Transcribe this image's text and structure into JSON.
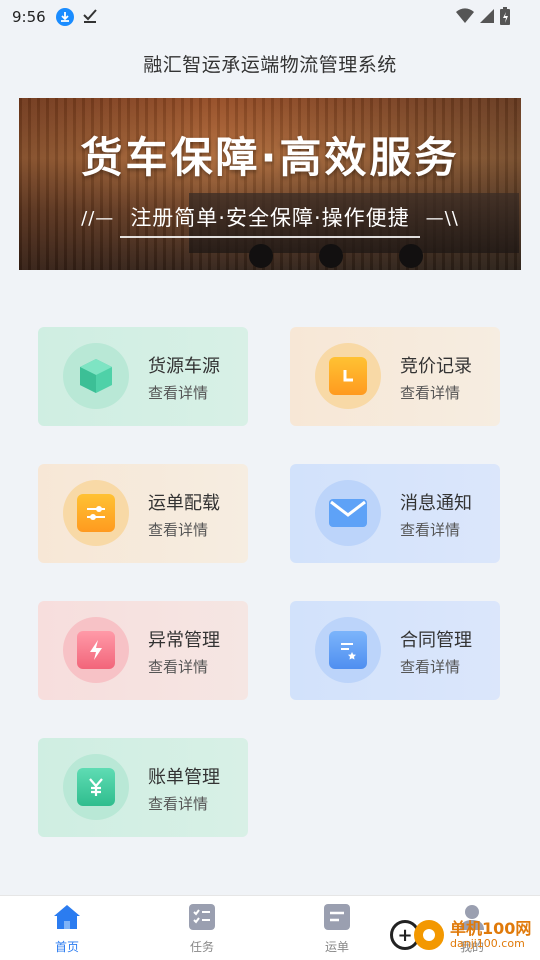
{
  "status_bar": {
    "time": "9:56",
    "icons": [
      "download-icon",
      "check-icon",
      "wifi-icon",
      "signal-icon",
      "battery-icon"
    ]
  },
  "header": {
    "title": "融汇智运承运端物流管理系统"
  },
  "banner": {
    "headline": "货车保障·高效服务",
    "subline": "注册简单·安全保障·操作便捷",
    "left_deco": "//—",
    "right_deco": "—\\\\"
  },
  "cards": [
    {
      "title": "货源车源",
      "subtitle": "查看详情",
      "icon": "cube-icon"
    },
    {
      "title": "竞价记录",
      "subtitle": "查看详情",
      "icon": "clock-icon"
    },
    {
      "title": "运单配载",
      "subtitle": "查看详情",
      "icon": "sliders-icon"
    },
    {
      "title": "消息通知",
      "subtitle": "查看详情",
      "icon": "mail-icon"
    },
    {
      "title": "异常管理",
      "subtitle": "查看详情",
      "icon": "lightning-icon"
    },
    {
      "title": "合同管理",
      "subtitle": "查看详情",
      "icon": "document-star-icon"
    },
    {
      "title": "账单管理",
      "subtitle": "查看详情",
      "icon": "yen-icon"
    }
  ],
  "bottom_nav": {
    "items": [
      {
        "label": "首页",
        "icon": "home-icon",
        "active": true
      },
      {
        "label": "任务",
        "icon": "task-list-icon",
        "active": false
      },
      {
        "label": "运单",
        "icon": "waybill-icon",
        "active": false
      },
      {
        "label": "我的",
        "icon": "user-icon",
        "active": false
      }
    ]
  },
  "watermark": {
    "line1": "单机100网",
    "line2": "danji100.com"
  },
  "colors": {
    "accent": "#2b7cf0",
    "green_card": "#d4efe4",
    "orange_card": "#f7eadb",
    "blue_card": "#d6e4fb",
    "red_card": "#f6e1df"
  }
}
